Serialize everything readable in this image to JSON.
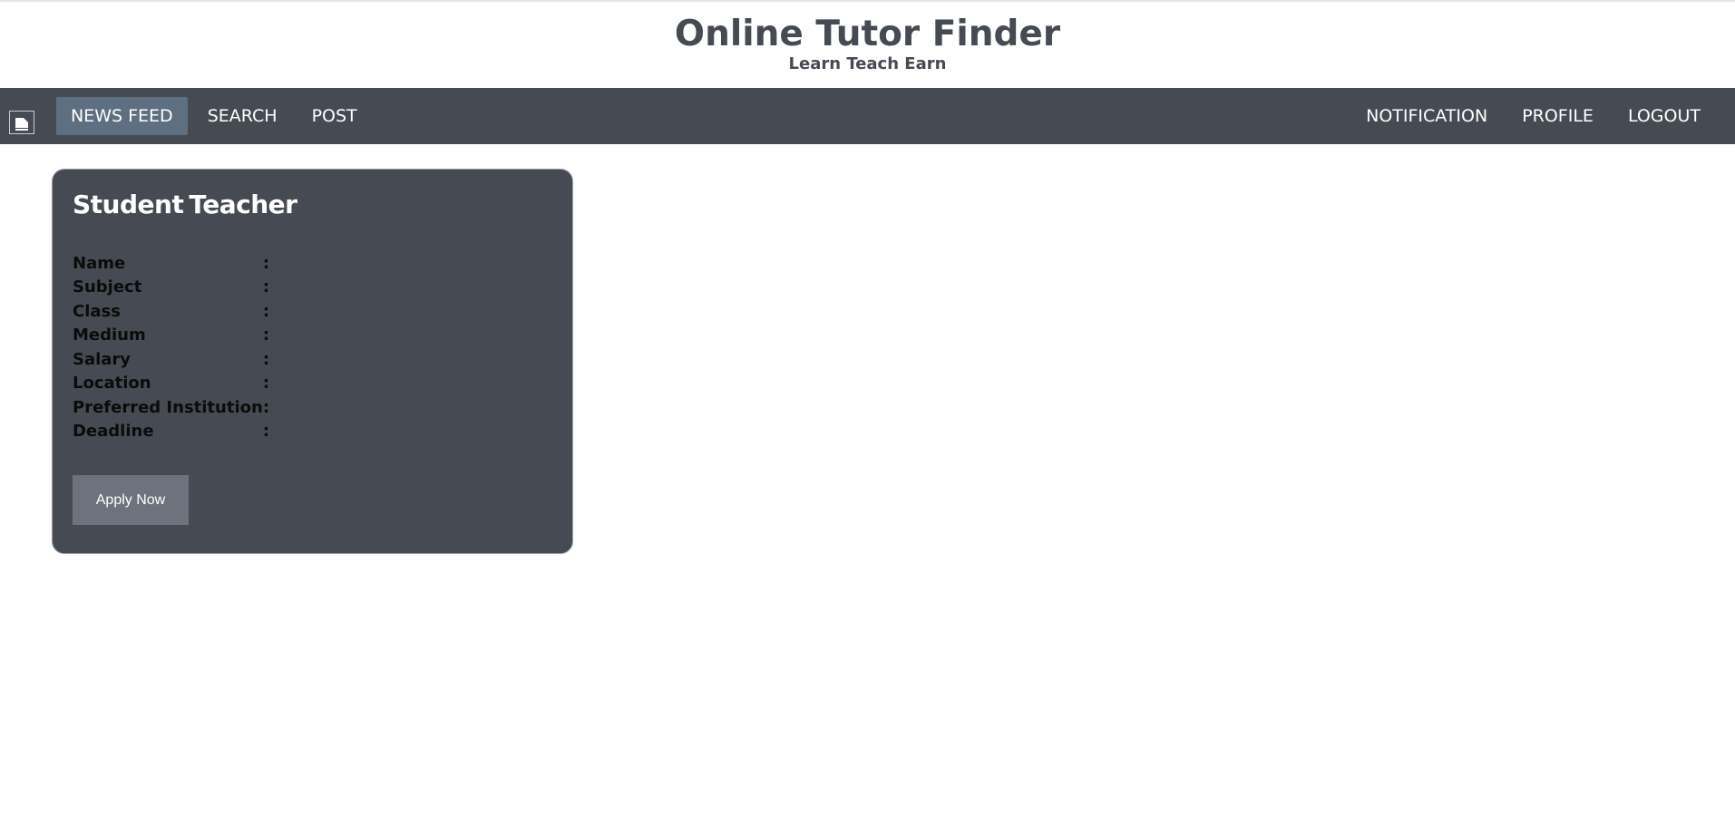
{
  "header": {
    "title": "Online Tutor Finder",
    "tagline": "Learn Teach Earn"
  },
  "nav": {
    "logo_icon": "books-logo-icon",
    "left_items": [
      {
        "label": "NEWS FEED",
        "active": true
      },
      {
        "label": "SEARCH",
        "active": false
      },
      {
        "label": "POST",
        "active": false
      }
    ],
    "right_items": [
      {
        "label": "NOTIFICATION"
      },
      {
        "label": "PROFILE"
      },
      {
        "label": "LOGOUT"
      }
    ]
  },
  "post": {
    "title_part1": "Student",
    "title_part2": "Teacher",
    "fields": [
      {
        "label": "Name",
        "sep": ":",
        "value": ""
      },
      {
        "label": "Subject",
        "sep": ":",
        "value": ""
      },
      {
        "label": "Class",
        "sep": ":",
        "value": ""
      },
      {
        "label": "Medium",
        "sep": ":",
        "value": ""
      },
      {
        "label": "Salary",
        "sep": ":",
        "value": ""
      },
      {
        "label": "Location",
        "sep": ":",
        "value": ""
      },
      {
        "label": "Preferred Institution",
        "sep": ":",
        "value": ""
      },
      {
        "label": "Deadline",
        "sep": ":",
        "value": ""
      }
    ],
    "apply_label": "Apply Now"
  },
  "colors": {
    "navbar_bg": "#464b53",
    "nav_active_bg": "#5d6f80",
    "card_bg": "#464b53",
    "button_bg": "#6c737c",
    "title_text": "#464a52"
  }
}
